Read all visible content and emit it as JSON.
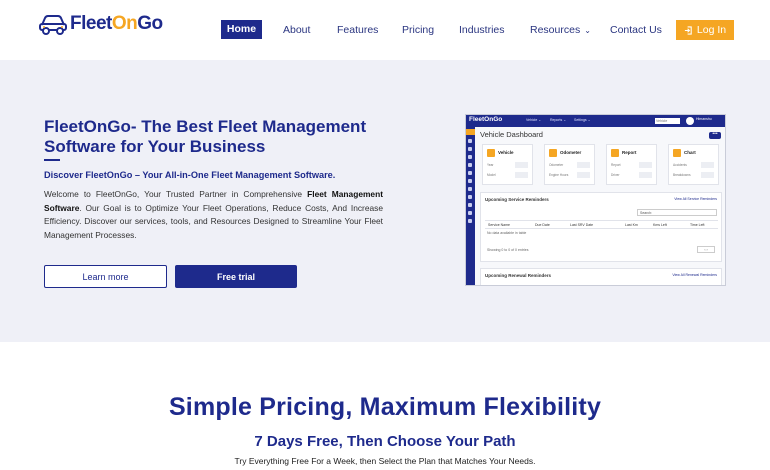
{
  "brand": {
    "logo_fleet": "Fleet",
    "logo_on": "On",
    "logo_go": "Go",
    "primary_color": "#1e2a8c",
    "accent_color": "#f5a623"
  },
  "nav": {
    "home": "Home",
    "about": "About",
    "features": "Features",
    "pricing": "Pricing",
    "industries": "Industries",
    "resources": "Resources",
    "contact": "Contact Us",
    "login": "Log In"
  },
  "hero": {
    "title": "FleetOnGo- The Best Fleet Management Software for Your Business",
    "subtitle": "Discover FleetOnGo – Your All-in-One Fleet Management Software.",
    "desc_part1": "Welcome to FleetOnGo, Your Trusted Partner in Comprehensive ",
    "desc_bold": "Fleet Management Software",
    "desc_part2": ". Our Goal is to Optimize Your Fleet Operations, Reduce Costs, And Increase Efficiency. Discover our services, tools, and Resources Designed to Streamline Your Fleet Management Processes.",
    "learn_more": "Learn more",
    "free_trial": "Free trial"
  },
  "dashboard": {
    "logo": "FleetOnGo",
    "menu": [
      "Vehicle ⌄",
      "Reports ⌄",
      "Settings ⌄"
    ],
    "search": "Vehicle",
    "user": "Himanshu",
    "title": "Vehicle Dashboard",
    "more": "•••",
    "cards": [
      {
        "title": "Vehicle",
        "rows": [
          "Year",
          "Model"
        ]
      },
      {
        "title": "Odometer",
        "rows": [
          "Odometer",
          "Engine Hours"
        ]
      },
      {
        "title": "Report",
        "rows": [
          "Report",
          "Driver"
        ]
      },
      {
        "title": "Chart",
        "rows": [
          "Accidents",
          "Breakdowns"
        ]
      }
    ],
    "service_title": "Upcoming Service Reminders",
    "service_link": "View All Service Reminders",
    "search_label": "Search:",
    "columns": [
      "Service Name",
      "Due Date",
      "Last SRV Date",
      "Last Km",
      "Kms Left",
      "Time Left"
    ],
    "empty": "No data available in table",
    "showing": "Showing 0 to 0 of 0 entries",
    "pager": "‹  ›",
    "renewal_title": "Upcoming Renewal Reminders",
    "renewal_link": "View All Renewal Reminders"
  },
  "pricing": {
    "title": "Simple Pricing, Maximum Flexibility",
    "subtitle": "7 Days Free, Then Choose Your Path",
    "desc": "Try Everything Free For a Week, then Select the Plan that Matches Your Needs."
  }
}
